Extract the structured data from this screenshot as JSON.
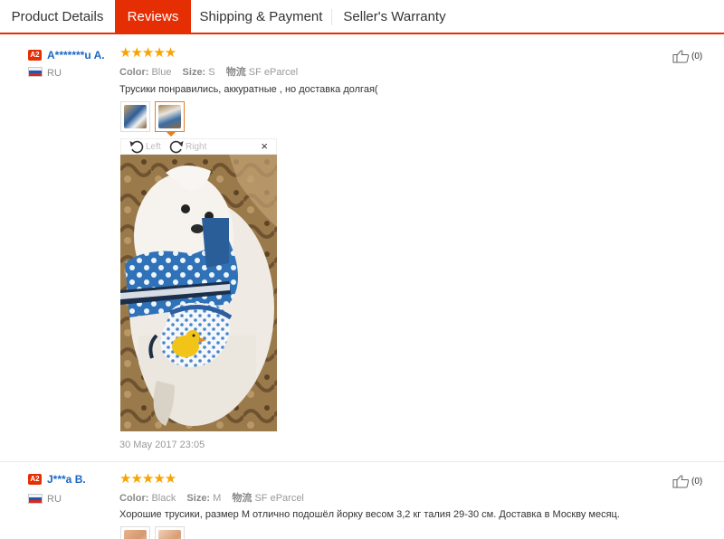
{
  "tabs": [
    {
      "label": "Product Details"
    },
    {
      "label": "Reviews"
    },
    {
      "label": "Shipping & Payment"
    },
    {
      "label": "Seller's Warranty"
    }
  ],
  "colors": {
    "accent": "#e62e04",
    "link": "#1a66c2",
    "star": "#f7a400"
  },
  "reviews": [
    {
      "level": "A2",
      "user": "A*******u A.",
      "country": "RU",
      "stars": "★★★★★",
      "rating": 5,
      "color_label": "Color:",
      "color_value": "Blue",
      "size_label": "Size:",
      "size_value": "S",
      "shipping_label": "物流",
      "shipping_value": "SF eParcel",
      "text": "Трусики понравились, аккуратные , но доставка долгая(",
      "helpful": "(0)",
      "viewer": {
        "left": "Left",
        "right": "Right",
        "close": "×"
      },
      "date": "30 May 2017 23:05"
    },
    {
      "level": "A2",
      "user": "J***a B.",
      "country": "RU",
      "stars": "★★★★★",
      "rating": 5,
      "color_label": "Color:",
      "color_value": "Black",
      "size_label": "Size:",
      "size_value": "M",
      "shipping_label": "物流",
      "shipping_value": "SF eParcel",
      "text": "Хорошие трусики, размер М отлично подошёл йорку весом 3,2 кг талия 29-30 см. Доставка в Москву месяц.",
      "helpful": "(0)"
    }
  ]
}
